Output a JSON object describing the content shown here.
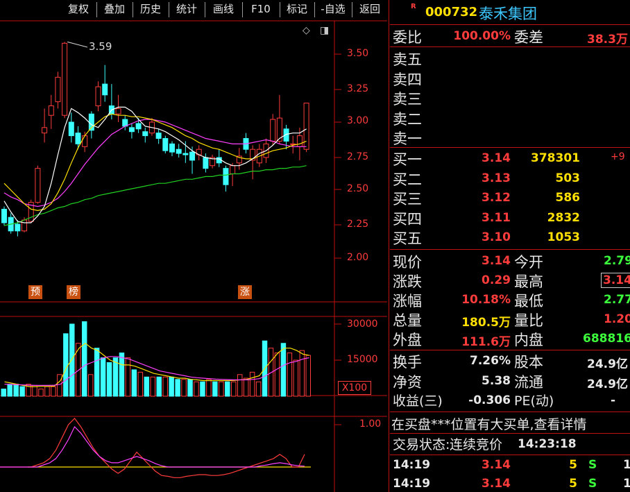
{
  "toolbar": {
    "buttons": [
      "复权",
      "叠加",
      "历史",
      "统计",
      "画线",
      "F10",
      "标记",
      "-自选",
      "返回"
    ]
  },
  "chart": {
    "ctrl_diamond": "◇",
    "ctrl_square": "◨",
    "high_label": "3.59",
    "price_ticks": [
      "3.50",
      "3.25",
      "3.00",
      "2.75",
      "2.50",
      "2.25",
      "2.00"
    ],
    "volume_ticks": [
      "30000",
      "15000"
    ],
    "volume_unit": "X100",
    "indicator_tick": "1.00",
    "tags": [
      "预",
      "榜",
      "涨"
    ],
    "colors": {
      "up": "#ff3c3c",
      "down": "#3cffff",
      "ma5": "#ffffff",
      "ma10": "#ffe000",
      "ma20": "#ff40ff",
      "ma60": "#20d020",
      "grid": "#c01010"
    }
  },
  "chart_data": {
    "type": "candlestick",
    "ylim": [
      2.0,
      3.6
    ],
    "price_ticks": [
      3.5,
      3.25,
      3.0,
      2.75,
      2.5,
      2.25,
      2.0
    ],
    "high_marker": 3.59,
    "candles": [
      {
        "o": 2.36,
        "c": 2.26,
        "h": 2.38,
        "l": 2.24
      },
      {
        "o": 2.3,
        "c": 2.2,
        "h": 2.33,
        "l": 2.18
      },
      {
        "o": 2.25,
        "c": 2.2,
        "h": 2.28,
        "l": 2.16
      },
      {
        "o": 2.2,
        "c": 2.28,
        "h": 2.3,
        "l": 2.19
      },
      {
        "o": 2.27,
        "c": 2.41,
        "h": 2.43,
        "l": 2.26
      },
      {
        "o": 2.41,
        "c": 2.66,
        "h": 2.68,
        "l": 2.4
      },
      {
        "o": 2.92,
        "c": 2.96,
        "h": 3.1,
        "l": 2.85
      },
      {
        "o": 3.05,
        "c": 3.12,
        "h": 3.2,
        "l": 2.95
      },
      {
        "o": 3.15,
        "c": 3.33,
        "h": 3.37,
        "l": 3.1
      },
      {
        "o": 3.05,
        "c": 3.58,
        "h": 3.59,
        "l": 3.03
      },
      {
        "o": 3.0,
        "c": 2.9,
        "h": 3.07,
        "l": 2.85
      },
      {
        "o": 2.92,
        "c": 2.84,
        "h": 2.97,
        "l": 2.8
      },
      {
        "o": 2.82,
        "c": 2.9,
        "h": 2.93,
        "l": 2.78
      },
      {
        "o": 3.06,
        "c": 2.94,
        "h": 3.08,
        "l": 2.88
      },
      {
        "o": 3.12,
        "c": 3.26,
        "h": 3.3,
        "l": 3.08
      },
      {
        "o": 3.28,
        "c": 3.2,
        "h": 3.42,
        "l": 3.15
      },
      {
        "o": 3.12,
        "c": 3.06,
        "h": 3.28,
        "l": 3.02
      },
      {
        "o": 3.06,
        "c": 3.1,
        "h": 3.2,
        "l": 3.0
      },
      {
        "o": 3.02,
        "c": 2.97,
        "h": 3.05,
        "l": 2.94
      },
      {
        "o": 2.96,
        "c": 2.93,
        "h": 2.99,
        "l": 2.88
      },
      {
        "o": 2.99,
        "c": 2.95,
        "h": 3.03,
        "l": 2.92
      },
      {
        "o": 2.93,
        "c": 2.9,
        "h": 2.96,
        "l": 2.85
      },
      {
        "o": 2.92,
        "c": 3.0,
        "h": 3.03,
        "l": 2.9
      },
      {
        "o": 2.92,
        "c": 2.88,
        "h": 2.95,
        "l": 2.84
      },
      {
        "o": 2.88,
        "c": 2.79,
        "h": 2.9,
        "l": 2.77
      },
      {
        "o": 2.84,
        "c": 2.78,
        "h": 2.86,
        "l": 2.75
      },
      {
        "o": 2.8,
        "c": 2.77,
        "h": 2.84,
        "l": 2.74
      },
      {
        "o": 2.77,
        "c": 2.76,
        "h": 2.86,
        "l": 2.7
      },
      {
        "o": 2.78,
        "c": 2.72,
        "h": 2.82,
        "l": 2.62
      },
      {
        "o": 2.76,
        "c": 2.8,
        "h": 2.83,
        "l": 2.72
      },
      {
        "o": 2.74,
        "c": 2.66,
        "h": 2.77,
        "l": 2.63
      },
      {
        "o": 2.68,
        "c": 2.74,
        "h": 2.76,
        "l": 2.66
      },
      {
        "o": 2.74,
        "c": 2.7,
        "h": 2.8,
        "l": 2.67
      },
      {
        "o": 2.66,
        "c": 2.54,
        "h": 2.68,
        "l": 2.49
      },
      {
        "o": 2.62,
        "c": 2.68,
        "h": 2.7,
        "l": 2.53
      },
      {
        "o": 2.7,
        "c": 2.75,
        "h": 2.81,
        "l": 2.65
      },
      {
        "o": 2.88,
        "c": 2.8,
        "h": 2.92,
        "l": 2.77
      },
      {
        "o": 2.72,
        "c": 2.8,
        "h": 2.83,
        "l": 2.58
      },
      {
        "o": 2.7,
        "c": 2.8,
        "h": 2.84,
        "l": 2.67
      },
      {
        "o": 2.74,
        "c": 2.84,
        "h": 2.88,
        "l": 2.7
      },
      {
        "o": 2.86,
        "c": 3.02,
        "h": 3.06,
        "l": 2.83
      },
      {
        "o": 2.86,
        "c": 3.03,
        "h": 3.2,
        "l": 2.84
      },
      {
        "o": 2.95,
        "c": 2.86,
        "h": 2.98,
        "l": 2.8
      },
      {
        "o": 2.84,
        "c": 2.84,
        "h": 2.9,
        "l": 2.77
      },
      {
        "o": 2.82,
        "c": 2.9,
        "h": 2.96,
        "l": 2.72
      },
      {
        "o": 2.8,
        "c": 3.14,
        "h": 3.14,
        "l": 2.78
      }
    ],
    "ma5": [
      2.42,
      2.34,
      2.27,
      2.26,
      2.26,
      2.31,
      2.38,
      2.55,
      2.76,
      2.96,
      3.1,
      3.07,
      3.03,
      2.98,
      2.96,
      3.02,
      3.09,
      3.11,
      3.11,
      3.08,
      3.02,
      2.97,
      2.96,
      2.95,
      2.93,
      2.9,
      2.87,
      2.83,
      2.79,
      2.76,
      2.74,
      2.73,
      2.73,
      2.7,
      2.68,
      2.68,
      2.7,
      2.73,
      2.77,
      2.79,
      2.83,
      2.88,
      2.91,
      2.92,
      2.92,
      2.95
    ],
    "ma10": [
      2.55,
      2.5,
      2.45,
      2.4,
      2.36,
      2.35,
      2.36,
      2.4,
      2.48,
      2.58,
      2.7,
      2.81,
      2.9,
      2.96,
      3.0,
      3.04,
      3.06,
      3.05,
      3.05,
      3.04,
      3.04,
      3.03,
      3.02,
      3.0,
      2.98,
      2.96,
      2.93,
      2.9,
      2.88,
      2.85,
      2.83,
      2.81,
      2.8,
      2.78,
      2.76,
      2.74,
      2.73,
      2.73,
      2.75,
      2.77,
      2.79,
      2.8,
      2.81,
      2.83,
      2.84,
      2.86
    ],
    "ma20": [
      2.48,
      2.45,
      2.43,
      2.4,
      2.39,
      2.38,
      2.39,
      2.41,
      2.44,
      2.49,
      2.55,
      2.62,
      2.69,
      2.75,
      2.81,
      2.86,
      2.91,
      2.94,
      2.97,
      2.99,
      3.01,
      3.02,
      3.02,
      3.01,
      3.0,
      2.98,
      2.96,
      2.94,
      2.92,
      2.9,
      2.88,
      2.87,
      2.86,
      2.85,
      2.84,
      2.84,
      2.84,
      2.85,
      2.86,
      2.87,
      2.86,
      2.84,
      2.83,
      2.82,
      2.82,
      2.82
    ],
    "ma60": [
      2.24,
      2.25,
      2.26,
      2.28,
      2.3,
      2.32,
      2.33,
      2.35,
      2.37,
      2.38,
      2.4,
      2.41,
      2.43,
      2.44,
      2.46,
      2.47,
      2.48,
      2.49,
      2.5,
      2.51,
      2.52,
      2.53,
      2.54,
      2.55,
      2.55,
      2.56,
      2.57,
      2.58,
      2.58,
      2.59,
      2.6,
      2.6,
      2.61,
      2.61,
      2.62,
      2.62,
      2.63,
      2.64,
      2.64,
      2.65,
      2.65,
      2.66,
      2.66,
      2.67,
      2.67,
      2.68
    ],
    "volume": [
      3000,
      5000,
      5000,
      4000,
      5000,
      4500,
      3000,
      4000,
      4000,
      9000,
      26000,
      30000,
      22000,
      31000,
      9000,
      20000,
      16000,
      14000,
      16000,
      18000,
      16000,
      11000,
      10000,
      8000,
      8000,
      8000,
      8000,
      8000,
      7000,
      7000,
      7000,
      6000,
      6000,
      7000,
      6000,
      6000,
      6000,
      6000,
      9000,
      7500,
      10000,
      6000,
      23000,
      20000,
      18000,
      22000,
      18000,
      15000,
      19000,
      17000
    ],
    "volume_ticks": [
      30000,
      15000
    ],
    "volume_ma5": [
      6000,
      5500,
      5000,
      4500,
      4000,
      4000,
      4100,
      4100,
      4200,
      6500,
      12000,
      16000,
      20000,
      22000,
      20000,
      19000,
      17000,
      15000,
      14000,
      13000,
      13000,
      12500,
      11500,
      10500,
      9500,
      9000,
      8500,
      8000,
      7500,
      7500,
      7000,
      6800,
      6500,
      6500,
      6500,
      6500,
      6500,
      6600,
      6800,
      7000,
      7800,
      8500,
      12000,
      15000,
      18000,
      20000,
      20000,
      19000,
      17500,
      17000
    ],
    "volume_ma10": [
      5000,
      4900,
      4800,
      4700,
      4600,
      4500,
      4500,
      4500,
      4600,
      5000,
      7000,
      9000,
      11000,
      13000,
      14000,
      15000,
      16000,
      16500,
      16500,
      16000,
      15500,
      14500,
      13500,
      12500,
      11500,
      10500,
      10000,
      9500,
      9000,
      8500,
      8000,
      7700,
      7500,
      7300,
      7100,
      7000,
      6900,
      6800,
      6800,
      6800,
      7000,
      7300,
      8500,
      10000,
      11500,
      13000,
      14000,
      14500,
      15500,
      16000
    ],
    "indicator_tick": 1.0,
    "indicator_a": [
      0.0,
      0.0,
      0.0,
      0.0,
      0.0,
      0.0,
      0.05,
      0.1,
      0.2,
      0.4,
      0.7,
      1.0,
      1.15,
      0.95,
      0.7,
      0.45,
      0.25,
      0.1,
      -0.05,
      -0.15,
      -0.05,
      0.15,
      0.35,
      0.2,
      0.05,
      -0.1,
      -0.2,
      -0.22,
      -0.25,
      -0.25,
      -0.22,
      -0.2,
      -0.18,
      -0.18,
      -0.2,
      -0.2,
      -0.18,
      -0.15,
      -0.1,
      -0.05,
      0.0,
      0.05,
      0.1,
      0.15,
      0.2,
      0.3,
      0.2,
      0.0,
      0.0,
      0.3
    ],
    "indicator_b": [
      0.0,
      0.0,
      0.0,
      0.0,
      0.0,
      0.0,
      0.0,
      0.05,
      0.1,
      0.2,
      0.4,
      0.65,
      0.95,
      0.8,
      0.6,
      0.4,
      0.25,
      0.15,
      0.1,
      0.1,
      0.15,
      0.2,
      0.25,
      0.2,
      0.15,
      0.08,
      0.03,
      0.0,
      0.0,
      0.0,
      0.0,
      0.0,
      0.0,
      0.0,
      0.0,
      0.0,
      0.0,
      0.0,
      0.0,
      0.0,
      0.0,
      0.0,
      0.03,
      0.05,
      0.08,
      0.1,
      0.08,
      0.05,
      0.03,
      0.02
    ],
    "indicator_baseline": 0.0
  },
  "panel": {
    "title_flag": "R",
    "code": "000732",
    "name": "泰禾集团",
    "webi_label": "委比",
    "webi_value": "100.00%",
    "weicha_label": "委差",
    "weicha_value": "38.3万",
    "sell_labels": [
      "卖五",
      "卖四",
      "卖三",
      "卖二",
      "卖一"
    ],
    "buy_rows": [
      {
        "label": "买一",
        "price": "3.14",
        "vol": "378301",
        "extra": "+9"
      },
      {
        "label": "买二",
        "price": "3.13",
        "vol": "503",
        "extra": ""
      },
      {
        "label": "买三",
        "price": "3.12",
        "vol": "586",
        "extra": ""
      },
      {
        "label": "买四",
        "price": "3.11",
        "vol": "2832",
        "extra": ""
      },
      {
        "label": "买五",
        "price": "3.10",
        "vol": "1053",
        "extra": ""
      }
    ],
    "stats1": [
      {
        "l1": "现价",
        "v1": "3.14",
        "l2": "今开",
        "v2": "2.79"
      },
      {
        "l1": "涨跌",
        "v1": "0.29",
        "l2": "最高",
        "v2": "3.14"
      },
      {
        "l1": "涨幅",
        "v1": "10.18%",
        "l2": "最低",
        "v2": "2.77"
      },
      {
        "l1": "总量",
        "v1": "180.5万",
        "l2": "量比",
        "v2": "1.20"
      },
      {
        "l1": "外盘",
        "v1": "111.6万",
        "l2": "内盘",
        "v2": "688816"
      }
    ],
    "stats2": [
      {
        "l1": "换手",
        "v1": "7.26%",
        "l2": "股本",
        "v2": "24.9亿"
      },
      {
        "l1": "净资",
        "v1": "5.38",
        "l2": "流通",
        "v2": "24.9亿"
      },
      {
        "l1": "收益(三)",
        "v1": "-0.306",
        "l2": "PE(动)",
        "v2": "-"
      }
    ],
    "notice": "在买盘***位置有大买单,查看详情",
    "status_label": "交易状态:",
    "status_value": "连续竞价",
    "status_time": "14:23:18",
    "ticks": [
      {
        "time": "14:19",
        "price": "3.14",
        "vol": "5",
        "side": "S",
        "n": "1"
      },
      {
        "time": "14:19",
        "price": "3.14",
        "vol": "5",
        "side": "S",
        "n": "1"
      }
    ]
  }
}
